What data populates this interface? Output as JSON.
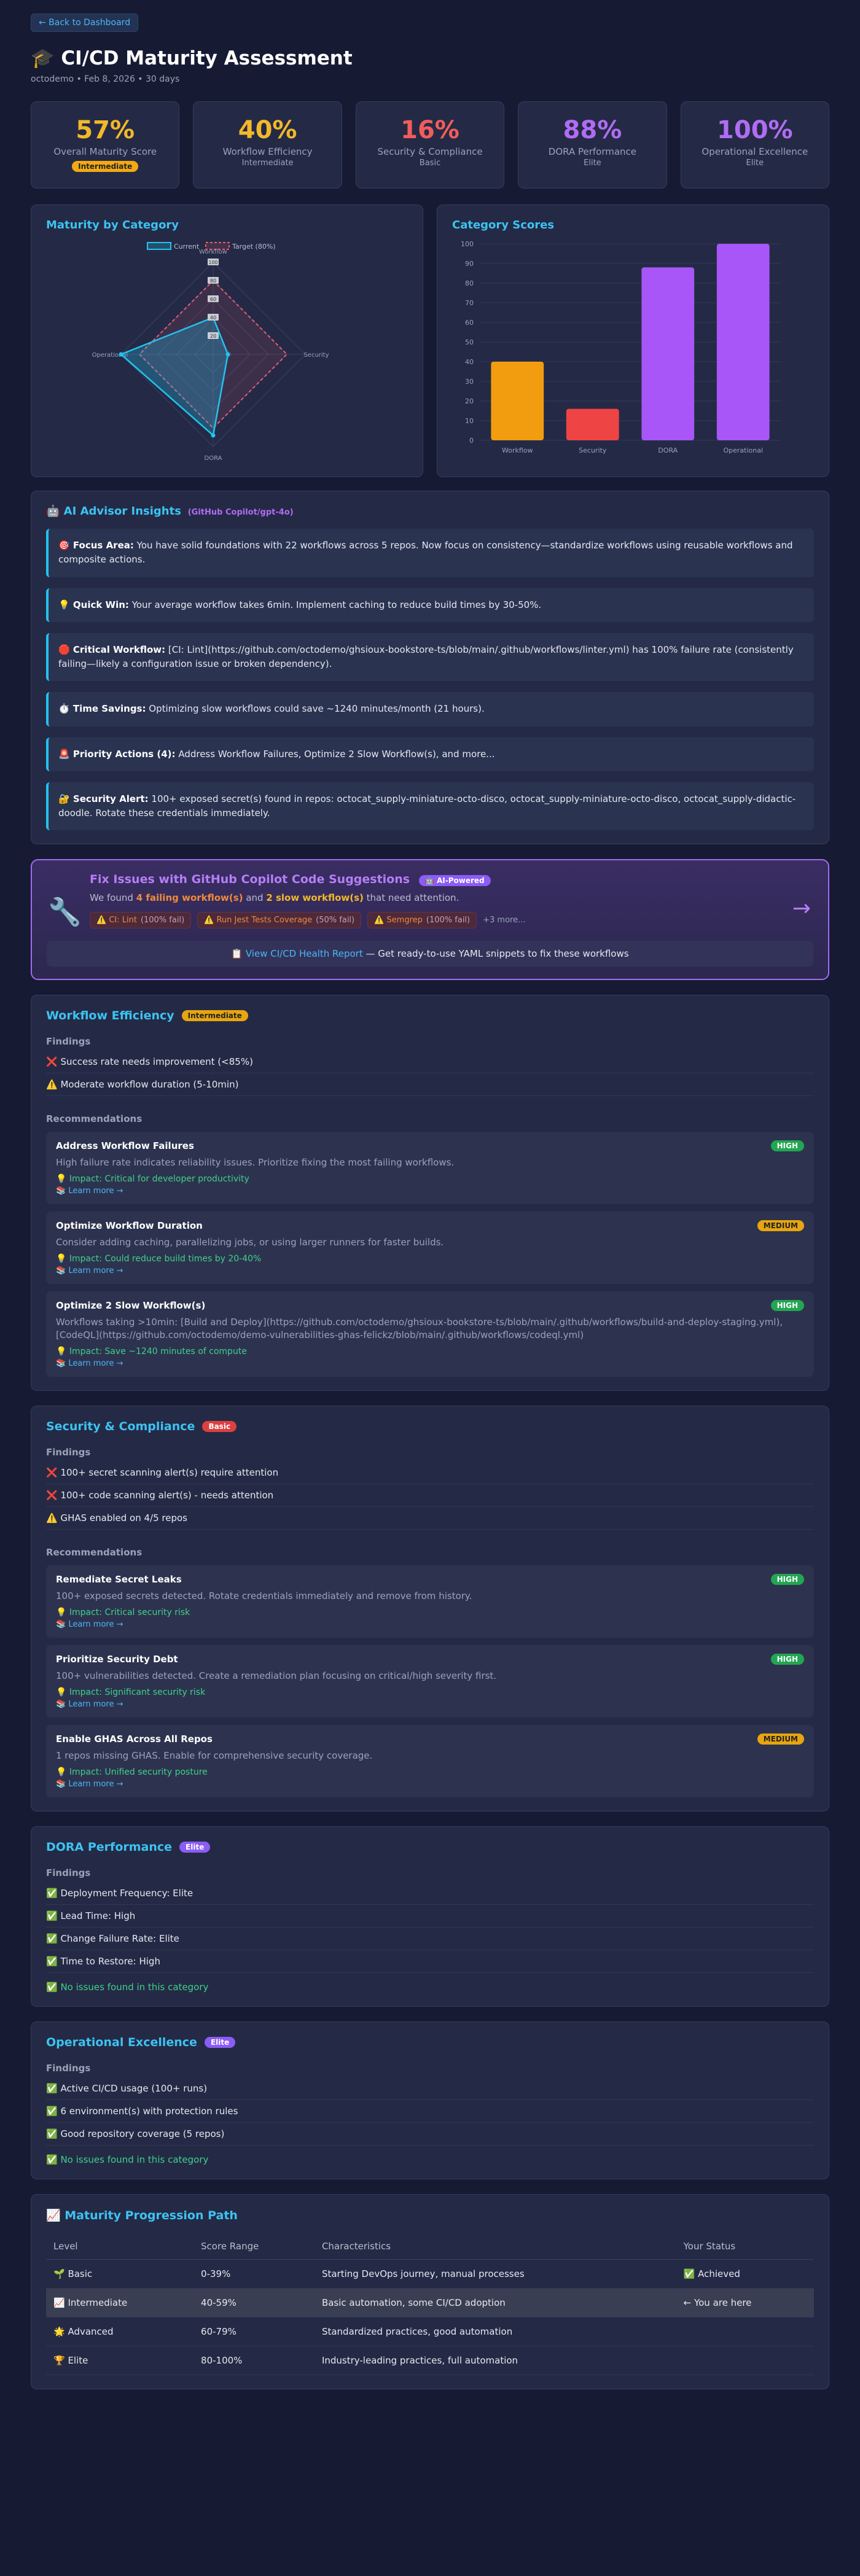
{
  "back_label": "← Back to Dashboard",
  "title": "🎓 CI/CD Maturity Assessment",
  "subtitle": "octodemo • Feb 8, 2026 • 30 days",
  "scores": [
    {
      "value": "57%",
      "label": "Overall Maturity Score",
      "sub": "",
      "badge": "Intermediate",
      "color": "#f2b82a"
    },
    {
      "value": "40%",
      "label": "Workflow Efficiency",
      "sub": "Intermediate",
      "badge": "",
      "color": "#f2b82a"
    },
    {
      "value": "16%",
      "label": "Security & Compliance",
      "sub": "Basic",
      "badge": "",
      "color": "#f25c5c"
    },
    {
      "value": "88%",
      "label": "DORA Performance",
      "sub": "Elite",
      "badge": "",
      "color": "#b06cf3"
    },
    {
      "value": "100%",
      "label": "Operational Excellence",
      "sub": "Elite",
      "badge": "",
      "color": "#b06cf3"
    }
  ],
  "radar": {
    "title": "Maturity by Category",
    "legend_current": "Current",
    "legend_target": "Target (80%)",
    "axes": [
      "Workflow",
      "Security",
      "DORA",
      "Operational"
    ],
    "current": [
      40,
      16,
      88,
      100
    ],
    "target": [
      80,
      80,
      80,
      80
    ],
    "ticks": [
      20,
      40,
      60,
      80,
      100
    ],
    "colors": {
      "current": "#22c3ee",
      "target": "#ec5c73"
    }
  },
  "chart_data": {
    "type": "bar",
    "title": "Category Scores",
    "categories": [
      "Workflow",
      "Security",
      "DORA",
      "Operational"
    ],
    "values": [
      40,
      16,
      88,
      100
    ],
    "colors": [
      "#f29d0f",
      "#ef4444",
      "#a856f7",
      "#a856f7"
    ],
    "ylim": [
      0,
      100
    ],
    "yticks": [
      0,
      10,
      20,
      30,
      40,
      50,
      60,
      70,
      80,
      90,
      100
    ]
  },
  "advisor": {
    "title": "🤖 AI Advisor Insights",
    "model": "(GitHub Copilot/gpt-4o)",
    "items": [
      {
        "head": "🎯 Focus Area:",
        "text": " You have solid foundations with 22 workflows across 5 repos. Now focus on consistency—standardize workflows using reusable workflows and composite actions."
      },
      {
        "head": "💡 Quick Win:",
        "text": " Your average workflow takes 6min. Implement caching to reduce build times by 30-50%."
      },
      {
        "head": "🛑 Critical Workflow:",
        "text": " [CI: Lint](https://github.com/octodemo/ghsioux-bookstore-ts/blob/main/.github/workflows/linter.yml) has 100% failure rate (consistently failing—likely a configuration issue or broken dependency)."
      },
      {
        "head": "⏱️ Time Savings:",
        "text": " Optimizing slow workflows could save ~1240 minutes/month (21 hours)."
      },
      {
        "head": "🚨 Priority Actions (4):",
        "text": " Address Workflow Failures, Optimize 2 Slow Workflow(s), and more..."
      },
      {
        "head": "🔐 Security Alert:",
        "text": " 100+ exposed secret(s) found in repos: octocat_supply-miniature-octo-disco, octocat_supply-miniature-octo-disco, octocat_supply-didactic-doodle. Rotate these credentials immediately."
      }
    ]
  },
  "copilot": {
    "title": "Fix Issues with GitHub Copilot Code Suggestions",
    "badge": "🤖 AI-Powered",
    "desc_pre": "We found ",
    "desc_fail": "4 failing workflow(s)",
    "desc_mid": " and ",
    "desc_slow": "2 slow workflow(s)",
    "desc_post": " that need attention.",
    "chips": [
      {
        "name": "⚠️ CI: Lint",
        "rate": "(100% fail)"
      },
      {
        "name": "⚠️ Run Jest Tests Coverage",
        "rate": "(50% fail)"
      },
      {
        "name": "⚠️ Semgrep",
        "rate": "(100% fail)"
      }
    ],
    "more": "+3 more...",
    "link_icon": "📋 ",
    "link": "View CI/CD Health Report",
    "link_post": " — Get ready-to-use YAML snippets to fix these workflows"
  },
  "categories": [
    {
      "title": "Workflow Efficiency",
      "level": "Intermediate",
      "level_bg": "#e7a50f",
      "level_fg": "#222",
      "findings_label": "Findings",
      "findings": [
        "❌ Success rate needs improvement (<85%)",
        "⚠️ Moderate workflow duration (5-10min)"
      ],
      "recs_label": "Recommendations",
      "recs": [
        {
          "title": "Address Workflow Failures",
          "prio": "HIGH",
          "desc": "High failure rate indicates reliability issues. Prioritize fixing the most failing workflows.",
          "impact": "💡 Impact: Critical for developer productivity",
          "link": "📚 Learn more →"
        },
        {
          "title": "Optimize Workflow Duration",
          "prio": "MEDIUM",
          "desc": "Consider adding caching, parallelizing jobs, or using larger runners for faster builds.",
          "impact": "💡 Impact: Could reduce build times by 20-40%",
          "link": "📚 Learn more →"
        },
        {
          "title": "Optimize 2 Slow Workflow(s)",
          "prio": "HIGH",
          "desc": "Workflows taking >10min: [Build and Deploy](https://github.com/octodemo/ghsioux-bookstore-ts/blob/main/.github/workflows/build-and-deploy-staging.yml), [CodeQL](https://github.com/octodemo/demo-vulnerabilities-ghas-felickz/blob/main/.github/workflows/codeql.yml)",
          "impact": "💡 Impact: Save ~1240 minutes of compute",
          "link": "📚 Learn more →"
        }
      ],
      "no_issues": ""
    },
    {
      "title": "Security & Compliance",
      "level": "Basic",
      "level_bg": "#dc4040",
      "level_fg": "#fff",
      "findings_label": "Findings",
      "findings": [
        "❌ 100+ secret scanning alert(s) require attention",
        "❌ 100+ code scanning alert(s) - needs attention",
        "⚠️ GHAS enabled on 4/5 repos"
      ],
      "recs_label": "Recommendations",
      "recs": [
        {
          "title": "Remediate Secret Leaks",
          "prio": "HIGH",
          "desc": "100+ exposed secrets detected. Rotate credentials immediately and remove from history.",
          "impact": "💡 Impact: Critical security risk",
          "link": "📚 Learn more →"
        },
        {
          "title": "Prioritize Security Debt",
          "prio": "HIGH",
          "desc": "100+ vulnerabilities detected. Create a remediation plan focusing on critical/high severity first.",
          "impact": "💡 Impact: Significant security risk",
          "link": "📚 Learn more →"
        },
        {
          "title": "Enable GHAS Across All Repos",
          "prio": "MEDIUM",
          "desc": "1 repos missing GHAS. Enable for comprehensive security coverage.",
          "impact": "💡 Impact: Unified security posture",
          "link": "📚 Learn more →"
        }
      ],
      "no_issues": ""
    },
    {
      "title": "DORA Performance",
      "level": "Elite",
      "level_bg": "#8b5cf6",
      "level_fg": "#fff",
      "findings_label": "Findings",
      "findings": [
        "✅ Deployment Frequency: Elite",
        "✅ Lead Time: High",
        "✅ Change Failure Rate: Elite",
        "✅ Time to Restore: High"
      ],
      "recs_label": "",
      "recs": [],
      "no_issues": "✅ No issues found in this category"
    },
    {
      "title": "Operational Excellence",
      "level": "Elite",
      "level_bg": "#8b5cf6",
      "level_fg": "#fff",
      "findings_label": "Findings",
      "findings": [
        "✅ Active CI/CD usage (100+ runs)",
        "✅ 6 environment(s) with protection rules",
        "✅ Good repository coverage (5 repos)"
      ],
      "recs_label": "",
      "recs": [],
      "no_issues": "✅ No issues found in this category"
    }
  ],
  "progression": {
    "title": "📈 Maturity Progression Path",
    "headers": [
      "Level",
      "Score Range",
      "Characteristics",
      "Your Status"
    ],
    "rows": [
      {
        "level": "🌱 Basic",
        "range": "0-39%",
        "chars": "Starting DevOps journey, manual processes",
        "status": "✅ Achieved",
        "current": false
      },
      {
        "level": "📈 Intermediate",
        "range": "40-59%",
        "chars": "Basic automation, some CI/CD adoption",
        "status": "← You are here",
        "current": true
      },
      {
        "level": "🌟 Advanced",
        "range": "60-79%",
        "chars": "Standardized practices, good automation",
        "status": "",
        "current": false
      },
      {
        "level": "🏆 Elite",
        "range": "80-100%",
        "chars": "Industry-leading practices, full automation",
        "status": "",
        "current": false
      }
    ]
  }
}
